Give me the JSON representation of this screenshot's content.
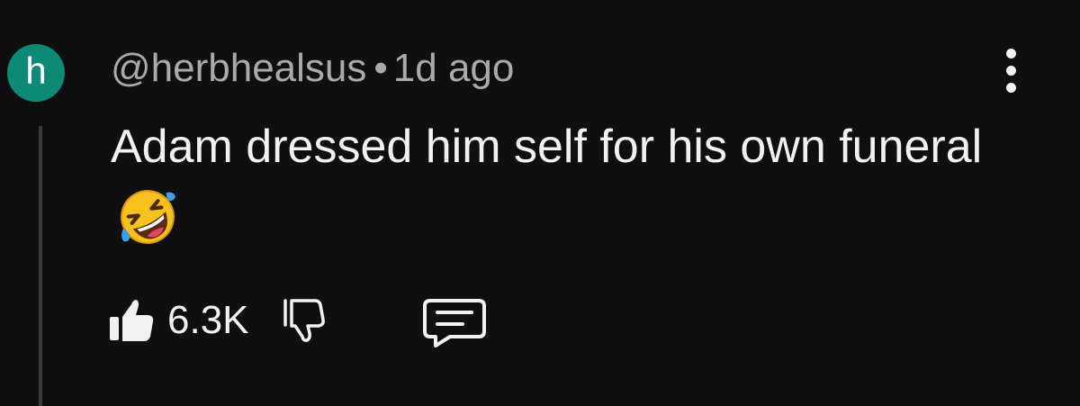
{
  "comment": {
    "avatar_letter": "h",
    "avatar_color": "#0d8a76",
    "author": "@herbhealsus",
    "separator": "•",
    "timestamp": "1d ago",
    "text": "Adam dressed him self for his own funeral",
    "emoji_icon": "rolling-on-the-floor-laughing-emoji",
    "likes": "6.3K"
  },
  "actions": {
    "like_icon": "thumbs-up-icon",
    "dislike_icon": "thumbs-down-icon",
    "reply_icon": "comment-icon",
    "more_icon": "more-vert-icon"
  }
}
